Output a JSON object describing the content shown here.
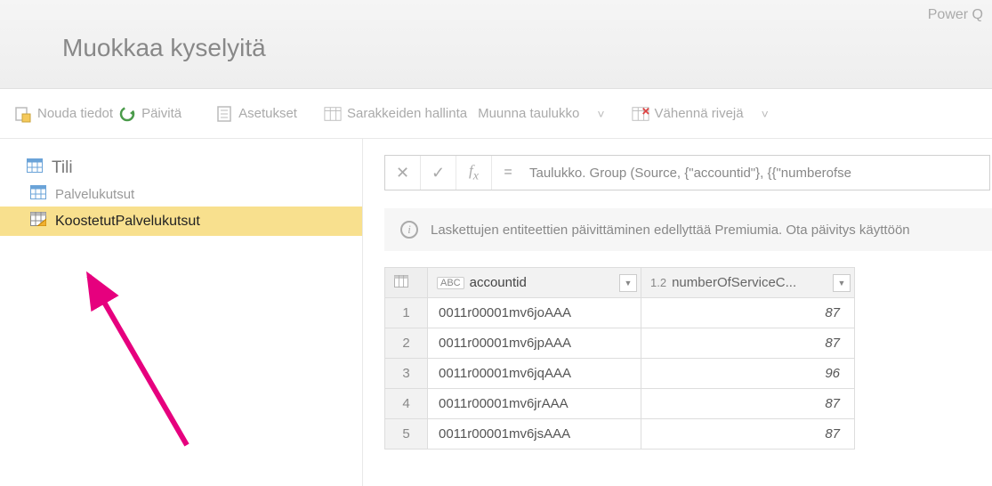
{
  "header": {
    "power_label": "Power Q",
    "title": "Muokkaa kyselyitä"
  },
  "toolbar": {
    "get_data": "Nouda tiedot",
    "refresh": "Päivitä",
    "settings": "Asetukset",
    "column_mgmt": "Sarakkeiden hallinta",
    "transform_table": "Muunna taulukko",
    "reduce_rows": "Vähennä rivejä"
  },
  "sidebar": {
    "queries": [
      {
        "label": "Tili",
        "type": "main"
      },
      {
        "label": "Palvelukutsut",
        "type": "sub"
      },
      {
        "label": "KoostetutPalvelukutsut",
        "type": "selected"
      }
    ]
  },
  "formula": {
    "text": "Taulukko. Group (Source, {\"accountid\"}, {{\"numberofse"
  },
  "info": {
    "message": "Laskettujen entiteettien päivittäminen edellyttää Premiumia. Ota päivitys käyttöön"
  },
  "table": {
    "columns": [
      {
        "type_badge": "ABC",
        "label": "accountid"
      },
      {
        "type_badge": "1.2",
        "label": "numberOfServiceC..."
      }
    ],
    "rows": [
      {
        "n": "1",
        "accountid": "0011r00001mv6joAAA",
        "value": "87"
      },
      {
        "n": "2",
        "accountid": "0011r00001mv6jpAAA",
        "value": "87"
      },
      {
        "n": "3",
        "accountid": "0011r00001mv6jqAAA",
        "value": "96"
      },
      {
        "n": "4",
        "accountid": "0011r00001mv6jrAAA",
        "value": "87"
      },
      {
        "n": "5",
        "accountid": "0011r00001mv6jsAAA",
        "value": "87"
      }
    ]
  }
}
